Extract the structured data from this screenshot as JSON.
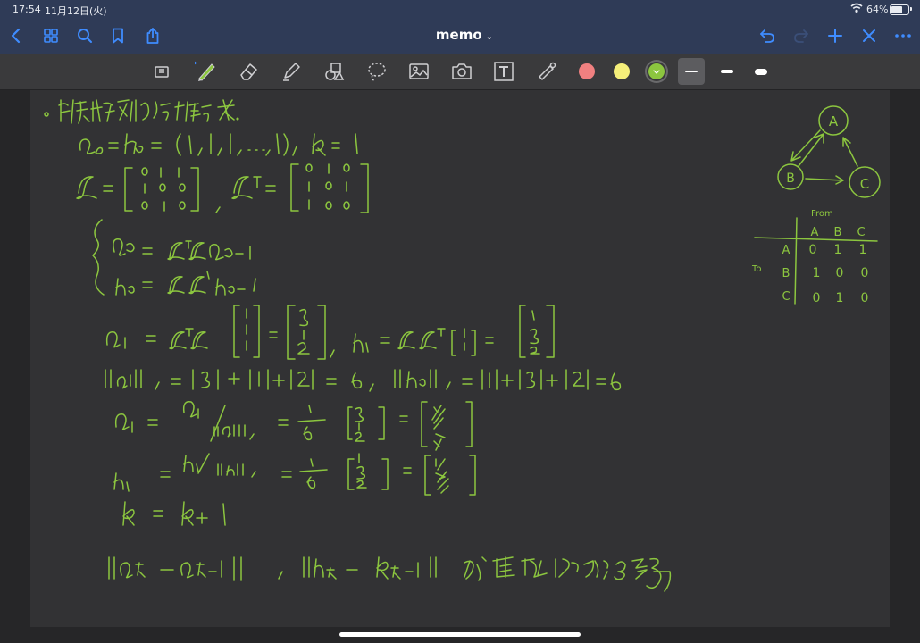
{
  "status": {
    "time": "17:54",
    "date": "11月12日(火)",
    "battery_percent": "64%",
    "battery_level": 0.64
  },
  "nav": {
    "title": "memo",
    "icons": [
      "back-icon",
      "grid-icon",
      "search-icon",
      "bookmark-icon",
      "share-icon",
      "undo-icon",
      "redo-icon",
      "add-icon",
      "close-icon",
      "more-icon"
    ]
  },
  "toolbar": {
    "tools": [
      "zoom-window-icon",
      "pen-icon",
      "eraser-icon",
      "highlighter-icon",
      "shapes-icon",
      "lasso-icon",
      "image-icon",
      "camera-icon",
      "text-icon",
      "laser-icon"
    ],
    "colors": [
      "#f08080",
      "#f5ef7a",
      "#8cc63f"
    ],
    "selected_color": "#8cc63f",
    "ink_color": "#8cc63f"
  },
  "note": {
    "graph": {
      "nodes": [
        "A",
        "B",
        "C"
      ]
    },
    "table": {
      "from_label": "From",
      "to_label": "To",
      "col_headers": [
        "A",
        "B",
        "C"
      ],
      "row_headers": [
        "A",
        "B",
        "C"
      ],
      "rows": [
        [
          "0",
          "1",
          "1"
        ],
        [
          "1",
          "0",
          "0"
        ],
        [
          "0",
          "1",
          "0"
        ]
      ]
    }
  }
}
